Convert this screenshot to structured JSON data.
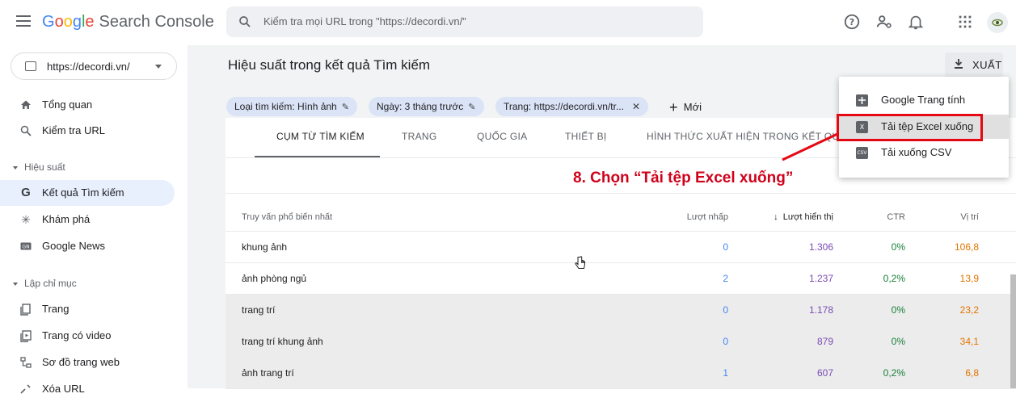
{
  "header": {
    "logo_parts": [
      "G",
      "o",
      "o",
      "g",
      "l",
      "e"
    ],
    "product_name": "Search Console",
    "search_placeholder": "Kiểm tra mọi URL trong \"https://decordi.vn/\""
  },
  "sidebar": {
    "property": "https://decordi.vn/",
    "items_top": [
      {
        "label": "Tổng quan",
        "icon": "home-icon"
      },
      {
        "label": "Kiểm tra URL",
        "icon": "search-icon"
      }
    ],
    "section_performance": "Hiệu suất",
    "items_performance": [
      {
        "label": "Kết quả Tìm kiếm",
        "icon": "google-g-icon"
      },
      {
        "label": "Khám phá",
        "icon": "asterisk-icon"
      },
      {
        "label": "Google News",
        "icon": "news-icon"
      }
    ],
    "section_index": "Lập chỉ mục",
    "items_index": [
      {
        "label": "Trang",
        "icon": "pages-icon"
      },
      {
        "label": "Trang có video",
        "icon": "video-page-icon"
      },
      {
        "label": "Sơ đồ trang web",
        "icon": "sitemap-icon"
      },
      {
        "label": "Xóa URL",
        "icon": "remove-icon"
      }
    ]
  },
  "main": {
    "title": "Hiệu suất trong kết quả Tìm kiếm",
    "export_label": "XUẤT",
    "filters": [
      "Loại tìm kiếm: Hình ảnh",
      "Ngày: 3 tháng trước",
      "Trang: https://decordi.vn/tr..."
    ],
    "new_label": "Mới",
    "tabs": [
      "CỤM TỪ TÌM KIẾM",
      "TRANG",
      "QUỐC GIA",
      "THIẾT BỊ",
      "HÌNH THỨC XUẤT HIỆN TRONG KẾT QUẢ TÌ"
    ],
    "table": {
      "headers": {
        "query": "Truy vấn phổ biến nhất",
        "clicks": "Lượt nhấp",
        "impressions": "Lượt hiển thị",
        "ctr": "CTR",
        "position": "Vị trí"
      },
      "rows": [
        {
          "query": "khung ảnh",
          "clicks": "0",
          "impressions": "1.306",
          "ctr": "0%",
          "position": "106,8"
        },
        {
          "query": "ảnh phòng ngủ",
          "clicks": "2",
          "impressions": "1.237",
          "ctr": "0,2%",
          "position": "13,9"
        },
        {
          "query": "trang trí",
          "clicks": "0",
          "impressions": "1.178",
          "ctr": "0%",
          "position": "23,2"
        },
        {
          "query": "trang trí khung ảnh",
          "clicks": "0",
          "impressions": "879",
          "ctr": "0%",
          "position": "34,1"
        },
        {
          "query": "ảnh trang trí",
          "clicks": "1",
          "impressions": "607",
          "ctr": "0,2%",
          "position": "6,8"
        }
      ]
    }
  },
  "export_menu": {
    "items": [
      {
        "label": "Google Trang tính",
        "icon": "sheets-icon"
      },
      {
        "label": "Tải tệp Excel xuống",
        "icon": "excel-icon",
        "icon_text": "X"
      },
      {
        "label": "Tải xuống CSV",
        "icon": "csv-icon",
        "icon_text": "CSV"
      }
    ]
  },
  "annotation": "8. Chọn “Tải tệp Excel xuống”"
}
